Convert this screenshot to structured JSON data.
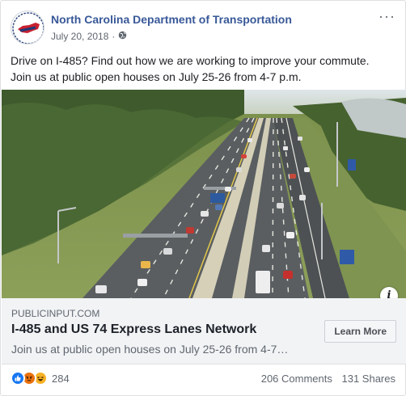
{
  "post": {
    "page_name": "North Carolina Department of Transportation",
    "date": "July 20, 2018",
    "separator": "·",
    "more_label": "···",
    "message_line1": "Drive on I-485? Find out how we are working to improve your commute.",
    "message_line2": "Join us at public open houses on July 25-26 from 4-7 p.m."
  },
  "link": {
    "domain": "PUBLICINPUT.COM",
    "title": "I-485 and US 74 Express Lanes Network",
    "description": "Join us at public open houses on July 25-26 from 4-7…",
    "button": "Learn More",
    "info_label": "i"
  },
  "footer": {
    "reaction_count": "284",
    "comments": "206 Comments",
    "shares": "131 Shares",
    "reactions": [
      "like-icon",
      "angry-icon",
      "haha-icon"
    ]
  },
  "colors": {
    "page_name": "#385898",
    "secondary_text": "#606770",
    "like": "#1877f2",
    "angry": "#e9710f",
    "haha": "#f7b125"
  }
}
